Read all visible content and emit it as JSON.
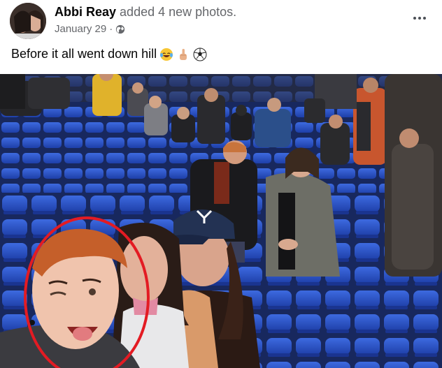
{
  "post": {
    "author": "Abbi Reay",
    "action": "added 4 new photos.",
    "date": "January 29",
    "separator": "·",
    "caption": "Before it all went down hill"
  },
  "icons": {
    "audience": "globe-icon",
    "more": "more-options-icon",
    "emojis": [
      "laughing-tears-emoji",
      "middle-finger-emoji",
      "soccer-ball-emoji"
    ]
  },
  "photo": {
    "description_visible": false,
    "highlight_color": "#e31b23",
    "seat_color": "#2f5bd6"
  }
}
